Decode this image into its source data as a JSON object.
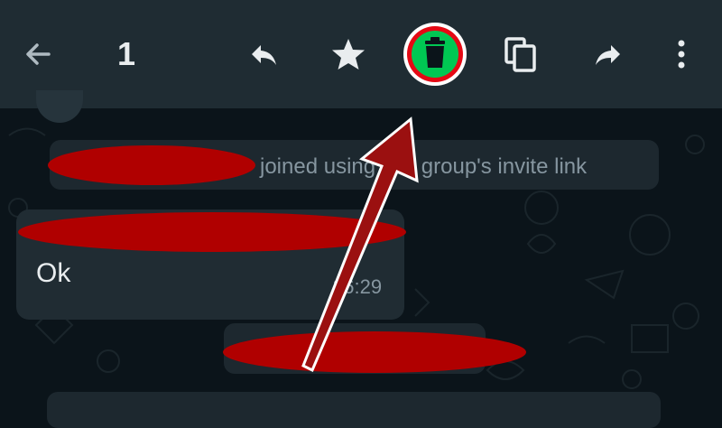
{
  "toolbar": {
    "selected_count": "1",
    "icons": [
      "back-arrow-icon",
      "reply-icon",
      "star-icon",
      "delete-icon",
      "copy-icon",
      "forward-icon",
      "more-options-icon"
    ],
    "highlight_color": "#00c853",
    "highlight_ring_color": "#e50914"
  },
  "chat": {
    "system_message": "joined using this group's invite link",
    "messages": [
      {
        "text": "Ok",
        "time": "16:29"
      }
    ]
  },
  "annotation": {
    "redaction_color": "#b00000",
    "arrow_color": "#9b1010"
  }
}
